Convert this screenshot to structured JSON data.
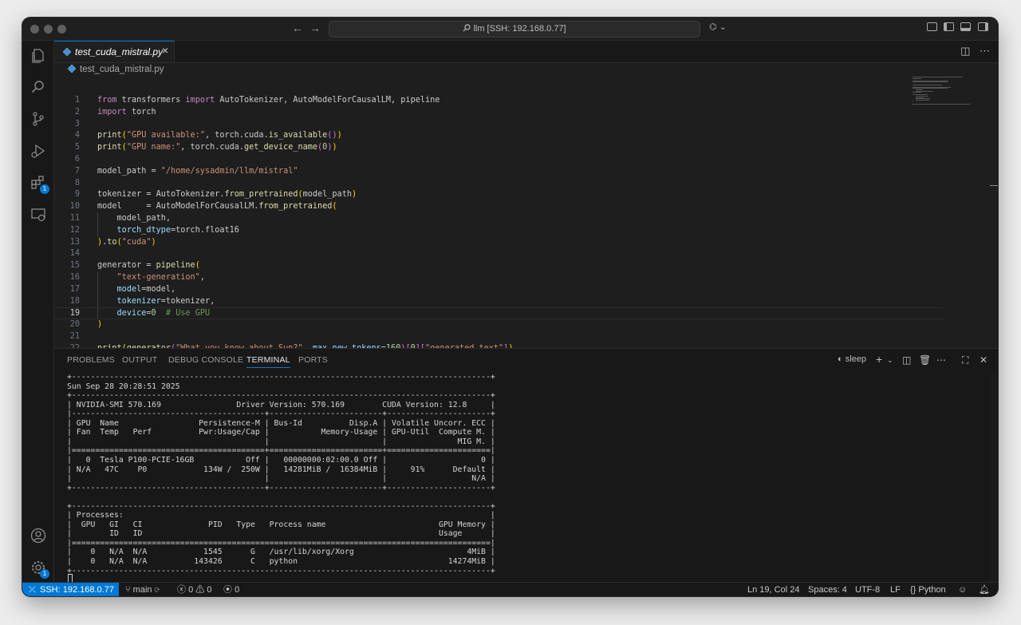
{
  "title_bar": {
    "command_center": "llm [SSH: 192.168.0.77]"
  },
  "activity_bar": {
    "extensions_badge": "1",
    "manage_badge": "1"
  },
  "tabs": [
    {
      "label": "test_cuda_mistral.py",
      "active": true
    }
  ],
  "breadcrumb": "test_cuda_mistral.py",
  "editor": {
    "active_line": 19,
    "lines": [
      "from transformers import AutoTokenizer, AutoModelForCausalLM, pipeline",
      "import torch",
      "",
      "print(\"GPU available:\", torch.cuda.is_available())",
      "print(\"GPU name:\", torch.cuda.get_device_name(0))",
      "",
      "model_path = \"/home/sysadmin/llm/mistral\"",
      "",
      "tokenizer = AutoTokenizer.from_pretrained(model_path)",
      "model     = AutoModelForCausalLM.from_pretrained(",
      "    model_path,",
      "    torch_dtype=torch.float16",
      ").to(\"cuda\")",
      "",
      "generator = pipeline(",
      "    \"text-generation\",",
      "    model=model,",
      "    tokenizer=tokenizer,",
      "    device=0  # Use GPU",
      ")",
      "",
      "print(generator(\"What you know about Sun?\", max_new_tokens=160)[0][\"generated_text\"])",
      ""
    ]
  },
  "panel": {
    "tabs": [
      "PROBLEMS",
      "OUTPUT",
      "DEBUG CONSOLE",
      "TERMINAL",
      "PORTS"
    ],
    "active_tab": "TERMINAL",
    "terminal_name": "sleep",
    "terminal_lines": [
      "+-----------------------------------------------------------------------------------------+",
      "Sun Sep 28 20:28:51 2025",
      "+-----------------------------------------------------------------------------------------+",
      "| NVIDIA-SMI 570.169                Driver Version: 570.169        CUDA Version: 12.8     |",
      "|-----------------------------------------+------------------------+----------------------+",
      "| GPU  Name                 Persistence-M | Bus-Id          Disp.A | Volatile Uncorr. ECC |",
      "| Fan  Temp   Perf          Pwr:Usage/Cap |           Memory-Usage | GPU-Util  Compute M. |",
      "|                                         |                        |               MIG M. |",
      "|=========================================+========================+======================|",
      "|   0  Tesla P100-PCIE-16GB           Off |   00000000:02:00.0 Off |                    0 |",
      "| N/A   47C    P0            134W /  250W |   14281MiB /  16384MiB |     91%      Default |",
      "|                                         |                        |                  N/A |",
      "+-----------------------------------------+------------------------+----------------------+",
      "",
      "+-----------------------------------------------------------------------------------------+",
      "| Processes:                                                                              |",
      "|  GPU   GI   CI              PID   Type   Process name                        GPU Memory |",
      "|        ID   ID                                                               Usage      |",
      "|=========================================================================================|",
      "|    0   N/A  N/A            1545      G   /usr/lib/xorg/Xorg                        4MiB |",
      "|    0   N/A  N/A          143426      C   python                                14274MiB |",
      "+-----------------------------------------------------------------------------------------+"
    ]
  },
  "status_bar": {
    "remote": "SSH: 192.168.0.77",
    "branch": "main",
    "errors": "0",
    "warnings": "0",
    "ports": "0",
    "cursor_position": "Ln 19, Col 24",
    "indent": "Spaces: 4",
    "encoding": "UTF-8",
    "eol": "LF",
    "language": "Python"
  },
  "colors": {
    "accent": "#0078d4",
    "editor_bg": "#1e1e1e",
    "panel_bg": "#181818"
  }
}
